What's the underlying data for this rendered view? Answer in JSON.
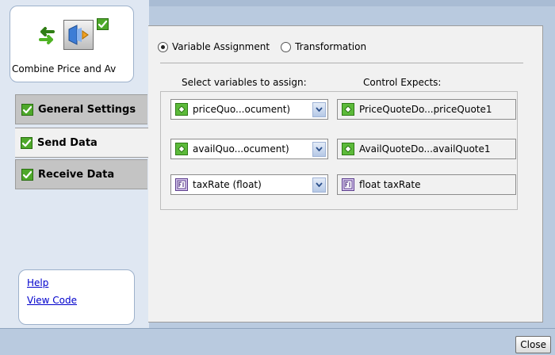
{
  "activity": {
    "label": "Combine Price and Av",
    "icons": [
      "swap-arrows-icon",
      "component-icon",
      "check-icon"
    ]
  },
  "nav": {
    "items": [
      {
        "label": "General Settings",
        "checked": true
      },
      {
        "label": "Send Data",
        "checked": true
      },
      {
        "label": "Receive Data",
        "checked": true
      }
    ]
  },
  "links": {
    "help": "Help",
    "view_code": "View Code"
  },
  "mode": {
    "options": [
      "Variable Assignment",
      "Transformation"
    ],
    "selected": "Variable Assignment"
  },
  "columns": {
    "select_header": "Select variables to assign:",
    "expects_header": "Control Expects:"
  },
  "assignments": [
    {
      "variable": "priceQuo...ocument)",
      "expects": "PriceQuoteDo...priceQuote1",
      "icon": "document-icon"
    },
    {
      "variable": "availQuo...ocument)",
      "expects": "AvailQuoteDo...availQuote1",
      "icon": "document-icon"
    },
    {
      "variable": "taxRate (float)",
      "expects": "float taxRate",
      "icon": "float-type-icon"
    }
  ],
  "footer": {
    "close_label": "Close"
  },
  "colors": {
    "accent_green": "#3f9a1e",
    "frame_blue": "#b9cadf",
    "link_blue": "#0000cc"
  }
}
